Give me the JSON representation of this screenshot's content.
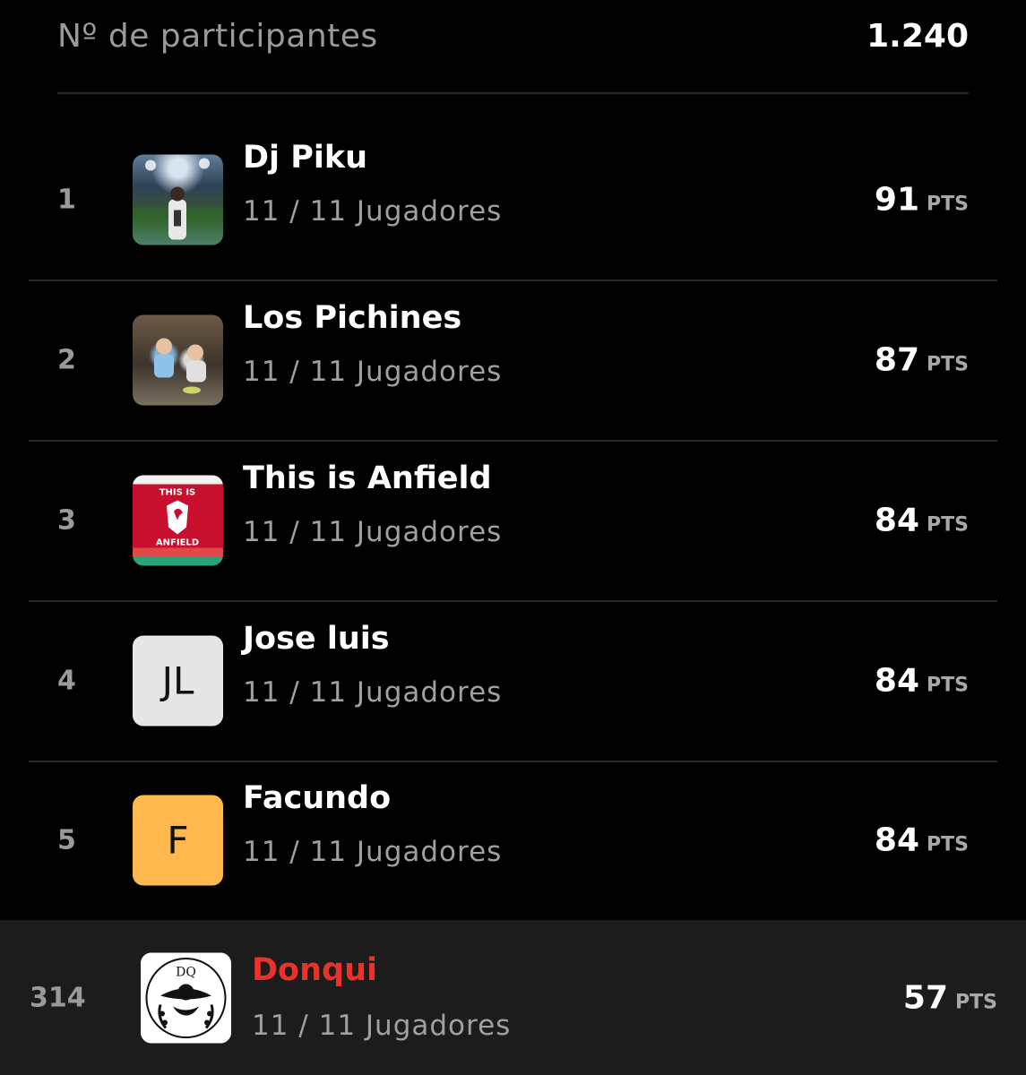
{
  "header": {
    "label": "Nº de participantes",
    "value": "1.240"
  },
  "unit": "PTS",
  "rows": [
    {
      "rank": "1",
      "name": "Dj Piku",
      "players": "11 / 11 Jugadores",
      "points": "91",
      "avatar": "photo-stadium"
    },
    {
      "rank": "2",
      "name": "Los Pichines",
      "players": "11 / 11 Jugadores",
      "points": "87",
      "avatar": "photo-kids"
    },
    {
      "rank": "3",
      "name": "This is Anfield",
      "players": "11 / 11 Jugadores",
      "points": "84",
      "avatar": "photo-anfield-sign",
      "avatar_text": [
        "THIS IS",
        "ANFIELD"
      ]
    },
    {
      "rank": "4",
      "name": "Jose luis",
      "players": "11 / 11 Jugadores",
      "points": "84",
      "initials": "JL"
    },
    {
      "rank": "5",
      "name": "Facundo",
      "players": "11 / 11 Jugadores",
      "points": "84",
      "initials": "F"
    }
  ],
  "me": {
    "rank": "314",
    "name": "Donqui",
    "players": "11 / 11 Jugadores",
    "points": "57",
    "avatar_text": "DQ"
  },
  "colors": {
    "background": "#000000",
    "highlight_row": "#1c1c1c",
    "me_name": "#e8322a",
    "avatar_f": "#ffb84d",
    "avatar_jl": "#e6e6e6"
  }
}
